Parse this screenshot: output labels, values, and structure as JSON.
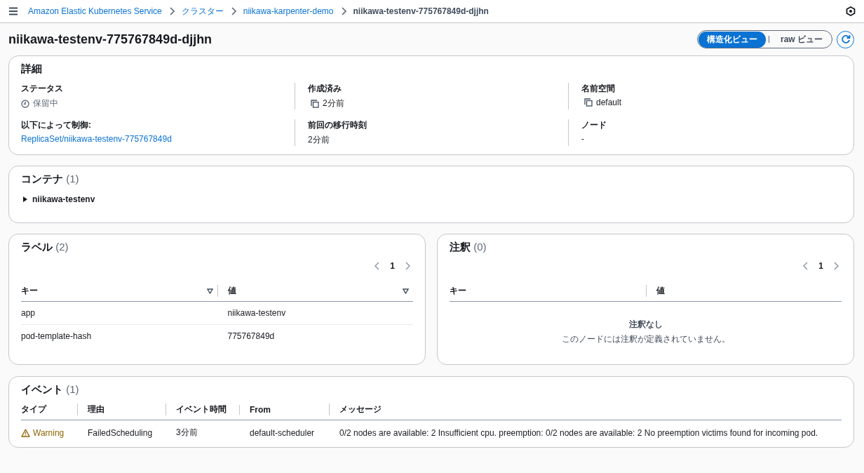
{
  "breadcrumbs": [
    {
      "label": "Amazon Elastic Kubernetes Service",
      "link": true
    },
    {
      "label": "クラスター",
      "link": true
    },
    {
      "label": "niikawa-karpenter-demo",
      "link": true
    },
    {
      "label": "niikawa-testenv-775767849d-djjhn",
      "link": false
    }
  ],
  "page_title": "niikawa-testenv-775767849d-djjhn",
  "view_toggle": [
    {
      "label": "構造化ビュー",
      "selected": true
    },
    {
      "label": "raw ビュー",
      "selected": false
    }
  ],
  "details": {
    "title": "詳細",
    "fields": [
      {
        "label": "ステータス",
        "value": "保留中",
        "kind": "status"
      },
      {
        "label": "作成済み",
        "value": "2分前",
        "kind": "copy"
      },
      {
        "label": "名前空間",
        "value": "default",
        "kind": "copy"
      },
      {
        "label": "以下によって制御:",
        "value": "ReplicaSet/niikawa-testenv-775767849d",
        "kind": "link"
      },
      {
        "label": "前回の移行時刻",
        "value": "2分前",
        "kind": "text"
      },
      {
        "label": "ノード",
        "value": "-",
        "kind": "text"
      }
    ]
  },
  "containers": {
    "title": "コンテナ",
    "count": "(1)",
    "items": [
      {
        "name": "niikawa-testenv",
        "expanded": false
      }
    ]
  },
  "labels": {
    "title": "ラベル",
    "count": "(2)",
    "page": "1",
    "columns": [
      {
        "label": "キー",
        "sortable": true
      },
      {
        "label": "値",
        "sortable": true
      }
    ],
    "rows": [
      [
        "app",
        "niikawa-testenv"
      ],
      [
        "pod-template-hash",
        "775767849d"
      ]
    ]
  },
  "annotations": {
    "title": "注釈",
    "count": "(0)",
    "page": "1",
    "columns": [
      {
        "label": "キー",
        "sortable": false
      },
      {
        "label": "値",
        "sortable": false
      }
    ],
    "empty_title": "注釈なし",
    "empty_text": "このノードには注釈が定義されていません。"
  },
  "events": {
    "title": "イベント",
    "count": "(1)",
    "columns": [
      "タイプ",
      "理由",
      "イベント時間",
      "From",
      "メッセージ"
    ],
    "rows": [
      {
        "type": "Warning",
        "kind": "warning",
        "reason": "FailedScheduling",
        "time": "3分前",
        "from": "default-scheduler",
        "message": "0/2 nodes are available: 2 Insufficient cpu. preemption: 0/2 nodes are available: 2 No preemption victims found for incoming pod."
      }
    ]
  }
}
